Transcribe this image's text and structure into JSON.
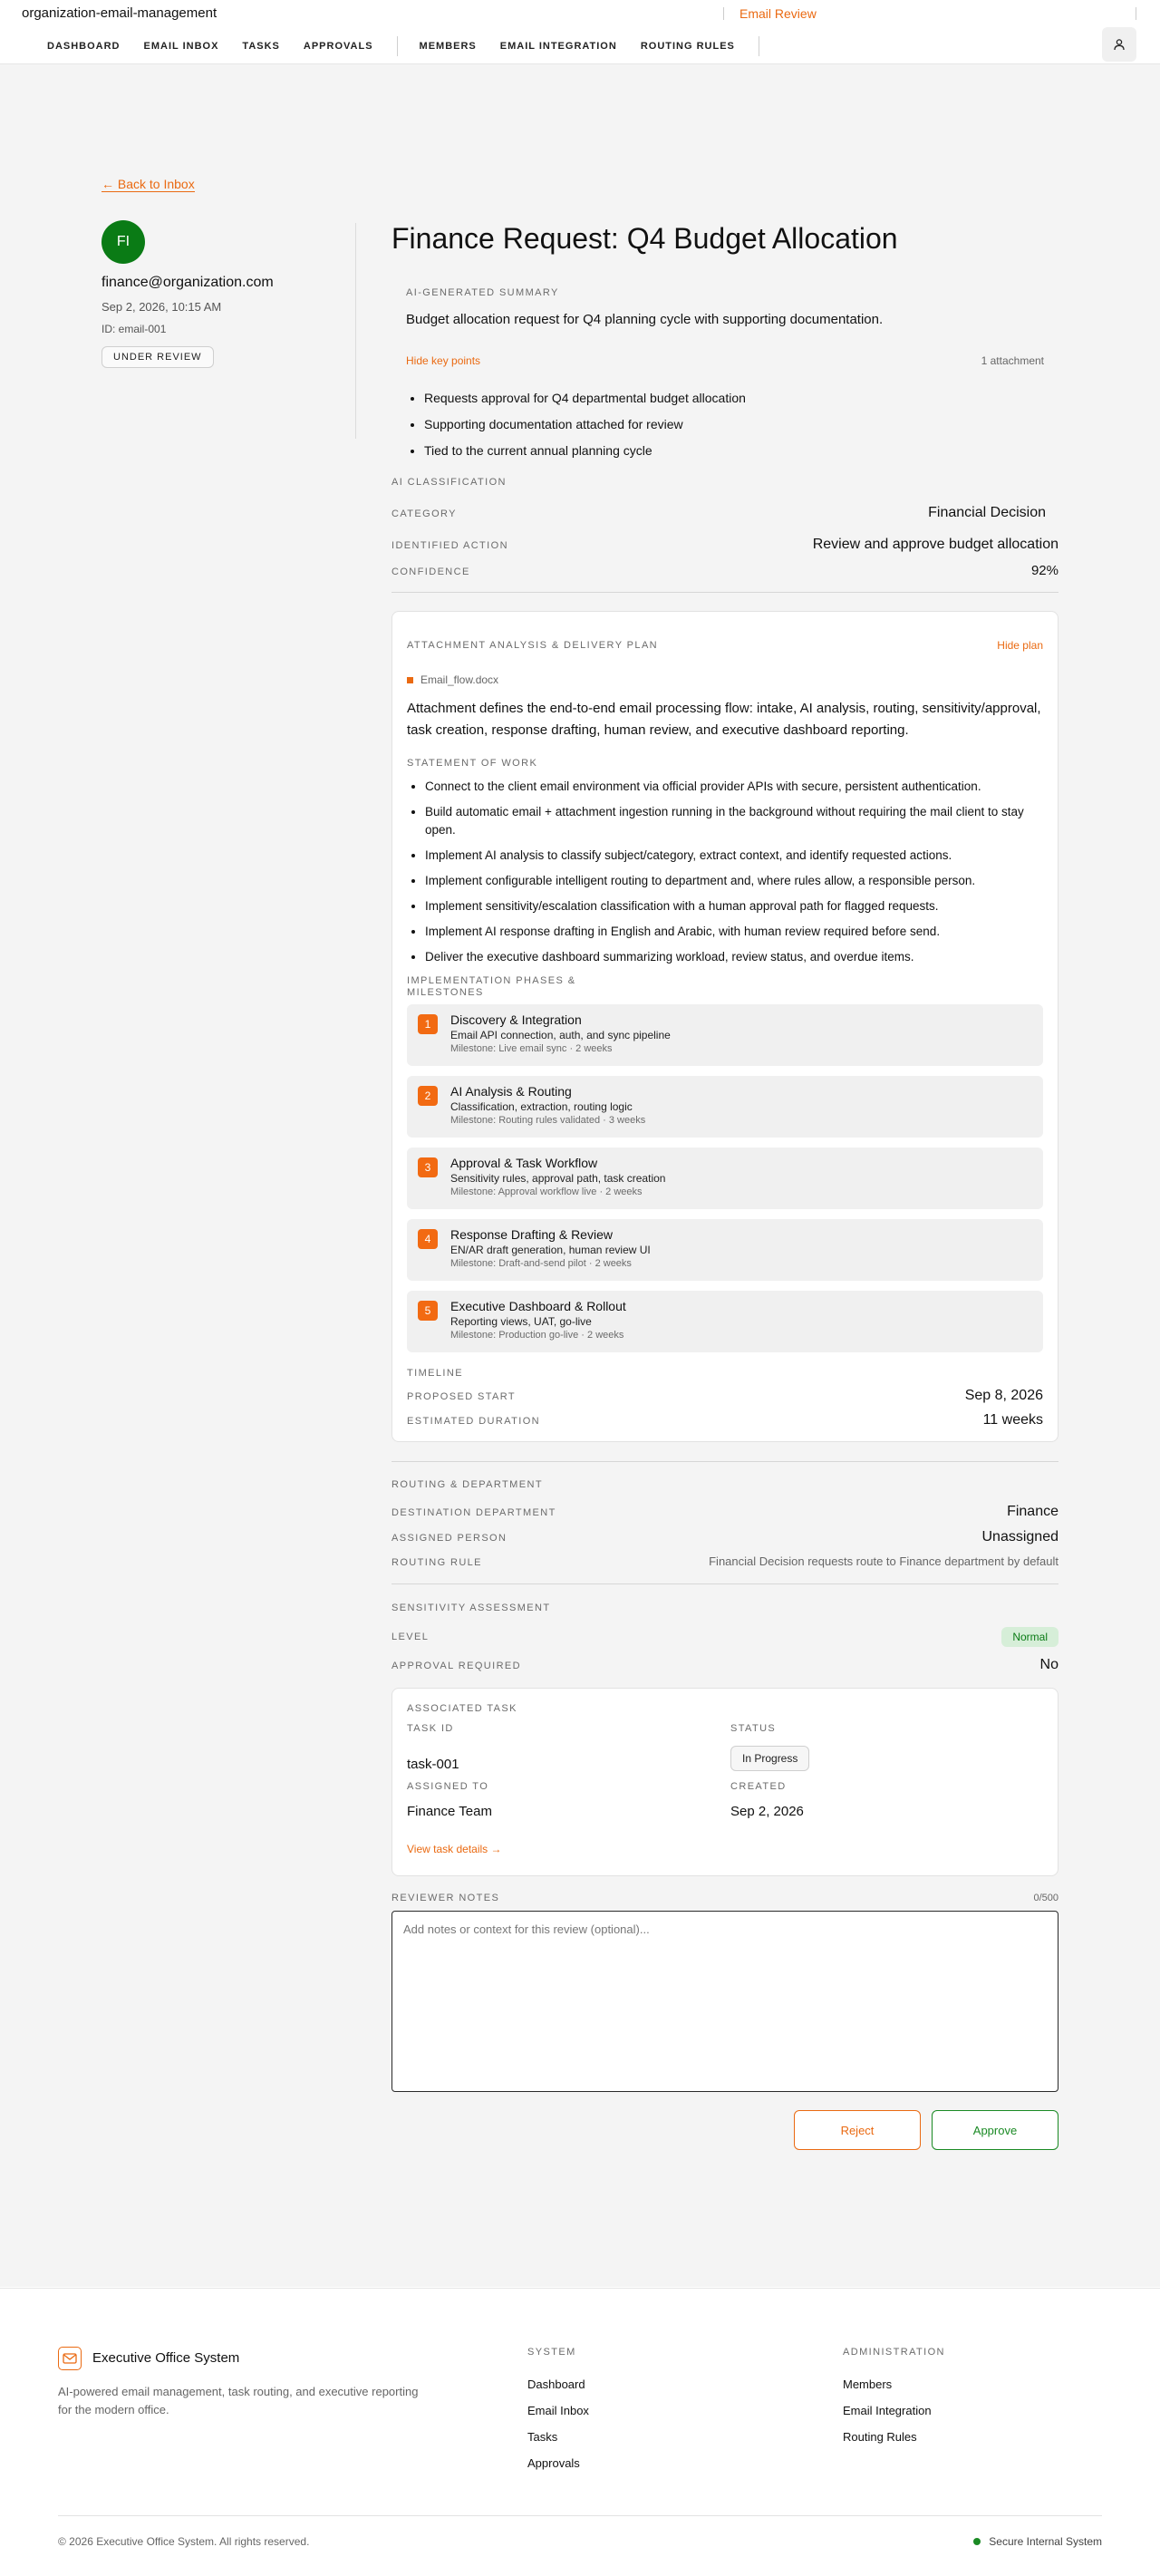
{
  "app": {
    "name": "organization-email-management",
    "current_page": "Email Review"
  },
  "nav": {
    "items_left": [
      "DASHBOARD",
      "EMAIL INBOX",
      "TASKS",
      "APPROVALS"
    ],
    "items_right": [
      "MEMBERS",
      "EMAIL INTEGRATION",
      "ROUTING RULES"
    ]
  },
  "back_link": "← Back to Inbox",
  "sender": {
    "initials": "FI",
    "email": "finance@organization.com",
    "date": "Sep 2, 2026, 10:15 AM",
    "id": "ID: email-001",
    "status": "UNDER REVIEW"
  },
  "title": "Finance Request: Q4 Budget Allocation",
  "summary": {
    "label": "AI-GENERATED SUMMARY",
    "text": "Budget allocation request for Q4 planning cycle with supporting documentation.",
    "toggle": "Hide key points",
    "attachments": "1 attachment",
    "key_points": [
      "Requests approval for Q4 departmental budget allocation",
      "Supporting documentation attached for review",
      "Tied to the current annual planning cycle"
    ]
  },
  "classification": {
    "label": "AI CLASSIFICATION",
    "category_label": "CATEGORY",
    "category": "Financial Decision",
    "action_label": "IDENTIFIED ACTION",
    "action": "Review and approve budget allocation",
    "confidence_label": "CONFIDENCE",
    "confidence": "92%"
  },
  "plan": {
    "label": "ATTACHMENT ANALYSIS & DELIVERY PLAN",
    "toggle": "Hide plan",
    "file": "Email_flow.docx",
    "description": "Attachment defines the end-to-end email processing flow: intake, AI analysis, routing, sensitivity/approval, task creation, response drafting, human review, and executive dashboard reporting.",
    "sow_label": "STATEMENT OF WORK",
    "sow": [
      "Connect to the client email environment via official provider APIs with secure, persistent authentication.",
      "Build automatic email + attachment ingestion running in the background without requiring the mail client to stay open.",
      "Implement AI analysis to classify subject/category, extract context, and identify requested actions.",
      "Implement configurable intelligent routing to department and, where rules allow, a responsible person.",
      "Implement sensitivity/escalation classification with a human approval path for flagged requests.",
      "Implement AI response drafting in English and Arabic, with human review required before send.",
      "Deliver the executive dashboard summarizing workload, review status, and overdue items."
    ],
    "phases_label_1": "IMPLEMENTATION PHASES &",
    "phases_label_2": "MILESTONES",
    "phases": [
      {
        "num": "1",
        "title": "Discovery & Integration",
        "sub": "Email API connection, auth, and sync pipeline",
        "milestone": "Milestone: Live email sync · 2 weeks"
      },
      {
        "num": "2",
        "title": "AI Analysis & Routing",
        "sub": "Classification, extraction, routing logic",
        "milestone": "Milestone: Routing rules validated · 3 weeks"
      },
      {
        "num": "3",
        "title": "Approval & Task Workflow",
        "sub": "Sensitivity rules, approval path, task creation",
        "milestone": "Milestone: Approval workflow live · 2 weeks"
      },
      {
        "num": "4",
        "title": "Response Drafting & Review",
        "sub": "EN/AR draft generation, human review UI",
        "milestone": "Milestone: Draft-and-send pilot · 2 weeks"
      },
      {
        "num": "5",
        "title": "Executive Dashboard & Rollout",
        "sub": "Reporting views, UAT, go-live",
        "milestone": "Milestone: Production go-live · 2 weeks"
      }
    ],
    "timeline_label": "TIMELINE",
    "start_label": "PROPOSED START",
    "start": "Sep 8, 2026",
    "duration_label": "ESTIMATED DURATION",
    "duration": "11 weeks"
  },
  "routing": {
    "label": "ROUTING & DEPARTMENT",
    "dest_label": "DESTINATION DEPARTMENT",
    "dest": "Finance",
    "person_label": "ASSIGNED PERSON",
    "person": "Unassigned",
    "rule_label": "ROUTING RULE",
    "rule": "Financial Decision requests route to Finance department by default"
  },
  "sensitivity": {
    "label": "SENSITIVITY ASSESSMENT",
    "level_label": "LEVEL",
    "level": "Normal",
    "approval_label": "APPROVAL REQUIRED",
    "approval": "No"
  },
  "task": {
    "label": "ASSOCIATED TASK",
    "id_label": "TASK ID",
    "id": "task-001",
    "status_label": "STATUS",
    "status": "In Progress",
    "assigned_label": "ASSIGNED TO",
    "assigned": "Finance Team",
    "created_label": "CREATED",
    "created": "Sep 2, 2026",
    "link": "View task details →"
  },
  "notes": {
    "label": "REVIEWER NOTES",
    "counter": "0/500",
    "placeholder": "Add notes or context for this review (optional)..."
  },
  "actions": {
    "reject": "Reject",
    "approve": "Approve"
  },
  "footer": {
    "brand": "Executive Office System",
    "desc": "AI-powered email management, task routing, and executive reporting for the modern office.",
    "system_label": "SYSTEM",
    "system_links": [
      "Dashboard",
      "Email Inbox",
      "Tasks",
      "Approvals"
    ],
    "admin_label": "ADMINISTRATION",
    "admin_links": [
      "Members",
      "Email Integration",
      "Routing Rules"
    ],
    "copyright": "© 2026 Executive Office System. All rights reserved.",
    "secure": "Secure Internal System"
  },
  "colors": {
    "accent": "#ea6a12",
    "success": "#1a8a24",
    "avatar": "#0a7b15"
  }
}
